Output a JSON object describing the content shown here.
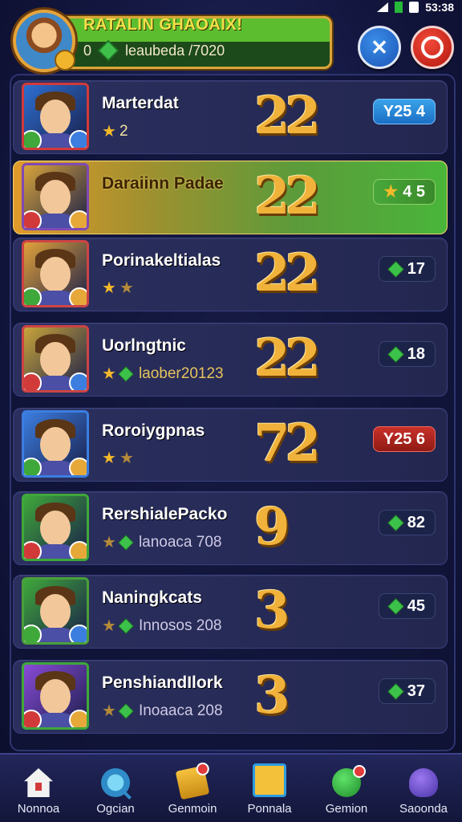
{
  "status_bar": {
    "time": "53:38"
  },
  "header": {
    "title": "RATALIN GHAOAIX!",
    "count": "0",
    "subtitle": "leaubeda /7020"
  },
  "rows": [
    {
      "name": "Marterdat",
      "stars": "2",
      "meta": "",
      "rank": "22",
      "pill": "Y25 4",
      "pill_style": "blue",
      "highlight": false
    },
    {
      "name": "Daraiinn Padae",
      "stars": "",
      "meta": "",
      "rank": "22",
      "pill": "4 5",
      "pill_style": "goldgreen",
      "highlight": true
    },
    {
      "name": "Porinakeltialas",
      "stars": "",
      "meta": "",
      "rank": "22",
      "pill": "17",
      "pill_style": "dark",
      "highlight": false
    },
    {
      "name": "Uorlngtnic",
      "stars": "",
      "meta": "laober20123",
      "rank": "22",
      "pill": "18",
      "pill_style": "dark",
      "highlight": false
    },
    {
      "name": "Roroiygpnas",
      "stars": "",
      "meta": "",
      "rank": "72",
      "pill": "Y25 6",
      "pill_style": "red",
      "highlight": false
    },
    {
      "name": "RershialePacko",
      "stars": "",
      "meta": "lanoaca 708",
      "rank": "9",
      "pill": "82",
      "pill_style": "dark",
      "highlight": false
    },
    {
      "name": "Naningkcats",
      "stars": "",
      "meta": "Innosos 208",
      "rank": "3",
      "pill": "45",
      "pill_style": "dark",
      "highlight": false
    },
    {
      "name": "PenshiandIlork",
      "stars": "",
      "meta": "Inoaaca 208",
      "rank": "3",
      "pill": "37",
      "pill_style": "dark",
      "highlight": false
    }
  ],
  "nav": [
    {
      "label": "Nonnoa",
      "icon": "home-icon"
    },
    {
      "label": "Ogcian",
      "icon": "search-icon"
    },
    {
      "label": "Genmoin",
      "icon": "chest-icon"
    },
    {
      "label": "Ponnala",
      "icon": "portrait-icon"
    },
    {
      "label": "Gemion",
      "icon": "gem-icon"
    },
    {
      "label": "Saoonda",
      "icon": "social-icon"
    }
  ],
  "colors": {
    "accent_gold": "#f0b23a",
    "highlight_green": "#49b53a",
    "panel_bg": "#232750"
  }
}
